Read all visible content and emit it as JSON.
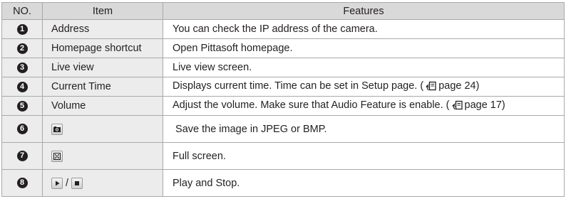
{
  "header": {
    "no": "NO.",
    "item": "Item",
    "features": "Features"
  },
  "rows": [
    {
      "no": "1",
      "item": "Address",
      "features": "You can check the IP address of the camera."
    },
    {
      "no": "2",
      "item": "Homepage shortcut",
      "features": "Open Pittasoft homepage."
    },
    {
      "no": "3",
      "item": "Live view",
      "features": "Live view screen."
    },
    {
      "no": "4",
      "item": "Current Time",
      "features_pre": "Displays current time. Time can be set in Setup page. (",
      "features_ref": "page 24)",
      "ref_icon": "page-reference-icon"
    },
    {
      "no": "5",
      "item": "Volume",
      "features_pre": "Adjust the volume. Make sure that Audio Feature is enable. (",
      "features_ref": "page 17)",
      "ref_icon": "page-reference-icon"
    },
    {
      "no": "6",
      "item_icon": "camera-icon",
      "features": " Save the image in JPEG or BMP."
    },
    {
      "no": "7",
      "item_icon": "fullscreen-icon",
      "features": "Full screen."
    },
    {
      "no": "8",
      "item_icons": [
        "play-icon",
        "stop-icon"
      ],
      "separator": "/",
      "features": "Play and Stop."
    }
  ]
}
